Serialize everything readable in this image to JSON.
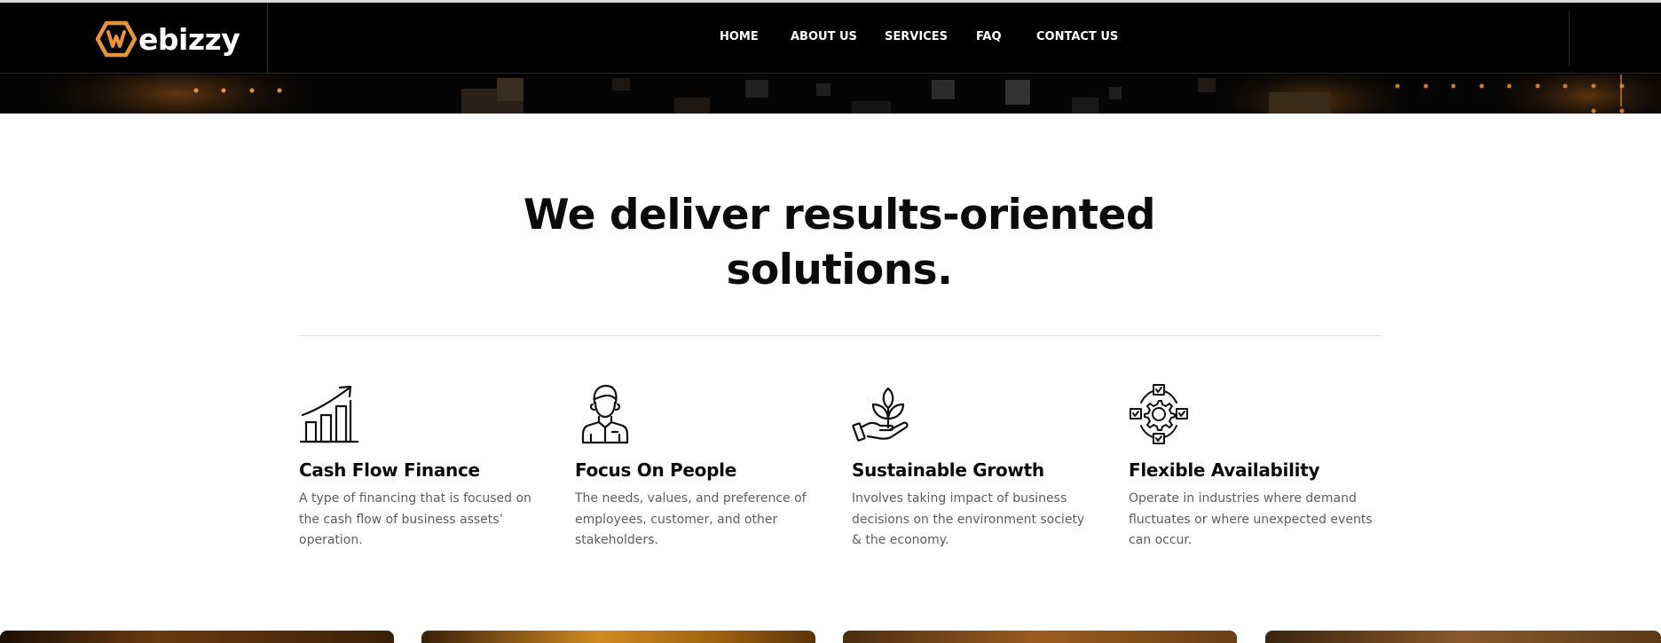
{
  "brand": {
    "name": "ebizzy",
    "accent": "#e8923a"
  },
  "nav": {
    "items": [
      {
        "label": "HOME"
      },
      {
        "label": "ABOUT US"
      },
      {
        "label": "SERVICES"
      },
      {
        "label": "FAQ"
      },
      {
        "label": "CONTACT US"
      }
    ]
  },
  "section": {
    "headline_line1": "We deliver results-oriented",
    "headline_line2": "solutions."
  },
  "features": [
    {
      "icon": "growth-chart-icon",
      "title": "Cash Flow Finance",
      "text": "A type of financing that is focused on the cash flow of business assets’ operation."
    },
    {
      "icon": "person-icon",
      "title": "Focus On People",
      "text": "The needs, values, and preference of employees, customer, and other stakeholders."
    },
    {
      "icon": "plant-in-hand-icon",
      "title": "Sustainable Growth",
      "text": "Involves taking impact of business decisions on the environment society & the economy."
    },
    {
      "icon": "gear-checklist-icon",
      "title": "Flexible Availability",
      "text": "Operate in industries where demand fluctuates or where unexpected events can occur."
    }
  ],
  "colors": {
    "header_bg": "#000000",
    "text_dark": "#0b0b0b",
    "text_muted": "#5d5d5d",
    "accent": "#e8923a"
  }
}
